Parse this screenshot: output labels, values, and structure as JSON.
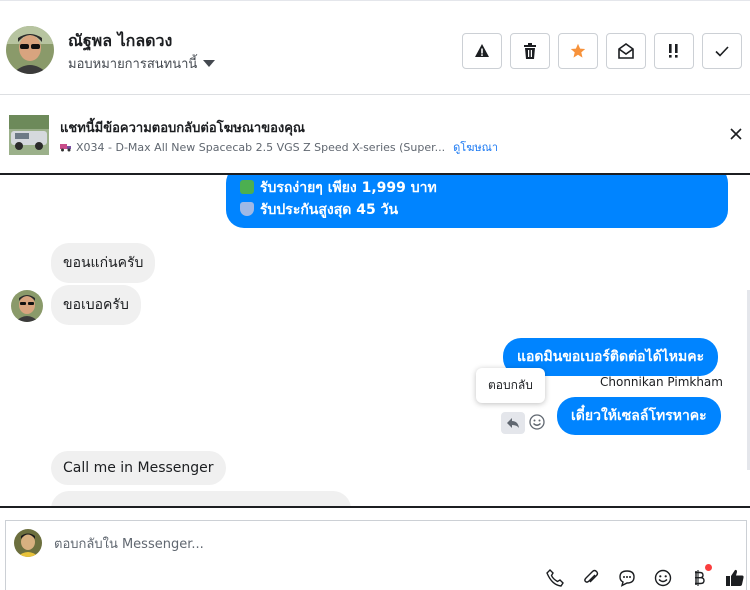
{
  "header": {
    "user_name": "ณัฐพล ไกลดวง",
    "assign_label": "มอบหมายการสนทนานี้",
    "actions": [
      "spam",
      "delete",
      "star",
      "mark-unread",
      "follow-up",
      "done"
    ],
    "colors": {
      "star": "#f7923b",
      "icon": "#1c1e21"
    }
  },
  "ad": {
    "title": "แชทนี้มีข้อความตอบกลับต่อโฆษณาของคุณ",
    "subtitle": "X034 - D-Max All New Spacecab 2.5 VGS Z Speed X-series (Super...",
    "link": "ดูโฆษณา"
  },
  "messages": {
    "top_line1": "รับรถง่ายๆ เพียง 1,999 บาท",
    "top_line2": "รับประกันสูงสุด 45 วัน",
    "in_1": "ขอนแก่นครับ",
    "in_2": "ขอเบอครับ",
    "out_1": "แอดมินขอเบอร์ติดต่อได้ไหมคะ",
    "sender_name": "Chonnikan Pimkham",
    "tooltip": "ตอบกลับ",
    "out_2": "เดี๋ยวให้เซลล์โทรหาคะ",
    "in_3": "Call me in Messenger"
  },
  "composer": {
    "placeholder": "ตอบกลับใน Messenger..."
  },
  "colors": {
    "outgoing_bubble": "#0084ff",
    "incoming_bubble": "#f0f0f0",
    "link": "#1877f2"
  }
}
